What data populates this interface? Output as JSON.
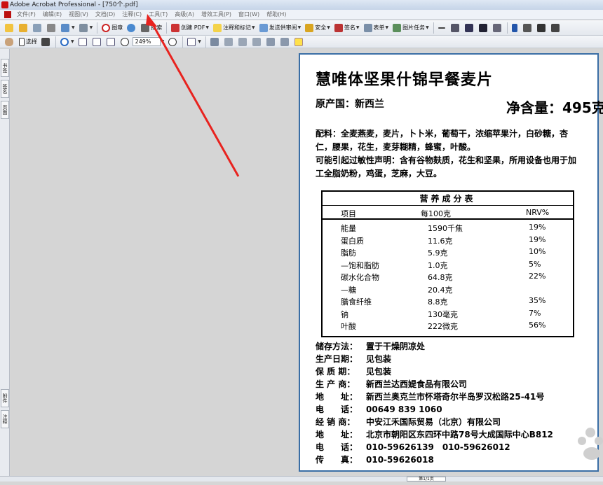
{
  "window": {
    "title": "Adobe Acrobat Professional - [750个.pdf]"
  },
  "menu": [
    "文件(F)",
    "编辑(E)",
    "视图(V)",
    "文档(D)",
    "注释(C)",
    "工具(T)",
    "高级(A)",
    "增效工具(P)",
    "窗口(W)",
    "帮助(H)"
  ],
  "toolbar1": {
    "figure": "图章",
    "search": "搜索",
    "create_pdf": "创建 PDF",
    "comment_markup": "注释和标记",
    "send_review": "发送供审阅",
    "security": "安全",
    "sign": "签名",
    "form": "表单",
    "picture_tasks": "图片任务"
  },
  "toolbar2": {
    "select": "选择",
    "zoom": "249%"
  },
  "left_tabs": [
    "书签",
    "签名",
    "页面",
    "附件",
    "注释"
  ],
  "status": {
    "page_indicator": "第1/1页"
  },
  "colors": {
    "arrow": "#e8231f",
    "page_border": "#3a6ea5"
  },
  "document": {
    "title": "慧唯体坚果什锦早餐麦片",
    "origin": "原产国：新西兰",
    "net_weight": "净含量：495克",
    "ingredients": "配料：全麦燕麦，麦片，卜卜米，葡萄干，浓缩苹果汁，白砂糖，杏仁，腰果，花生，麦芽糊精，蜂蜜，叶酸。",
    "allergy": "可能引起过敏性声明：含有谷物麸质，花生和坚果，所用设备也用于加工全脂奶粉，鸡蛋，芝麻，大豆。",
    "nutrition": {
      "header": "营养成分表",
      "columns": [
        "项目",
        "每100克",
        "NRV%"
      ],
      "rows": [
        {
          "item": "能量",
          "per100g": "1590千焦",
          "nrv": "19%"
        },
        {
          "item": "蛋白质",
          "per100g": "11.6克",
          "nrv": "19%"
        },
        {
          "item": "脂肪",
          "per100g": "5.9克",
          "nrv": "10%"
        },
        {
          "item": "—饱和脂肪",
          "per100g": "1.0克",
          "nrv": "5%"
        },
        {
          "item": "碳水化合物",
          "per100g": "64.8克",
          "nrv": "22%"
        },
        {
          "item": "—糖",
          "per100g": "20.4克",
          "nrv": ""
        },
        {
          "item": "膳食纤维",
          "per100g": "8.8克",
          "nrv": "35%"
        },
        {
          "item": "钠",
          "per100g": "130毫克",
          "nrv": "7%"
        },
        {
          "item": "叶酸",
          "per100g": "222微克",
          "nrv": "56%"
        }
      ]
    },
    "info": [
      {
        "k": "储存方法：",
        "v": "置于干燥阴凉处"
      },
      {
        "k": "生产日期：",
        "v": "见包装"
      },
      {
        "k": "保 质 期：",
        "v": "见包装"
      },
      {
        "k": "生 产 商：",
        "v": "新西兰达西媞食品有限公司"
      },
      {
        "k": "地　　址：",
        "v": "新西兰奥克兰市怀塔奇尔半岛罗汉松路25-41号"
      },
      {
        "k": "电　　话：",
        "v": "00649 839 1060"
      },
      {
        "k": "经 销 商：",
        "v": "中安江禾国际贸易（北京）有限公司"
      },
      {
        "k": "地　　址：",
        "v": "北京市朝阳区东四环中路78号大成国际中心B812"
      },
      {
        "k": "电　　话：",
        "v": "010-59626139　010-59626012"
      },
      {
        "k": "传　　真：",
        "v": "010-59626018"
      }
    ]
  }
}
